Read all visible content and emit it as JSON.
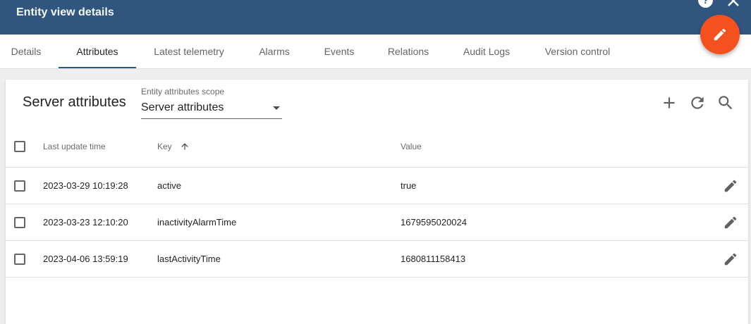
{
  "header": {
    "title": "Entity view details",
    "help_icon_glyph": "?",
    "color": "#305680"
  },
  "fab": {
    "icon": "edit-icon",
    "color": "#f4511e"
  },
  "tabs": [
    {
      "label": "Details",
      "active": false
    },
    {
      "label": "Attributes",
      "active": true
    },
    {
      "label": "Latest telemetry",
      "active": false
    },
    {
      "label": "Alarms",
      "active": false
    },
    {
      "label": "Events",
      "active": false
    },
    {
      "label": "Relations",
      "active": false
    },
    {
      "label": "Audit Logs",
      "active": false
    },
    {
      "label": "Version control",
      "active": false
    }
  ],
  "card": {
    "title": "Server attributes",
    "scope": {
      "label": "Entity attributes scope",
      "value": "Server attributes"
    },
    "toolbar": [
      "add-icon",
      "refresh-icon",
      "search-icon"
    ]
  },
  "table": {
    "headers": {
      "last_update": "Last update time",
      "key": "Key",
      "value": "Value"
    },
    "sort": {
      "column": "key",
      "direction": "ascending"
    },
    "rows": [
      {
        "last_update": "2023-03-29 10:19:28",
        "key": "active",
        "value": "true"
      },
      {
        "last_update": "2023-03-23 12:10:20",
        "key": "inactivityAlarmTime",
        "value": "1679595020024"
      },
      {
        "last_update": "2023-04-06 13:59:19",
        "key": "lastActivityTime",
        "value": "1680811158413"
      }
    ]
  }
}
